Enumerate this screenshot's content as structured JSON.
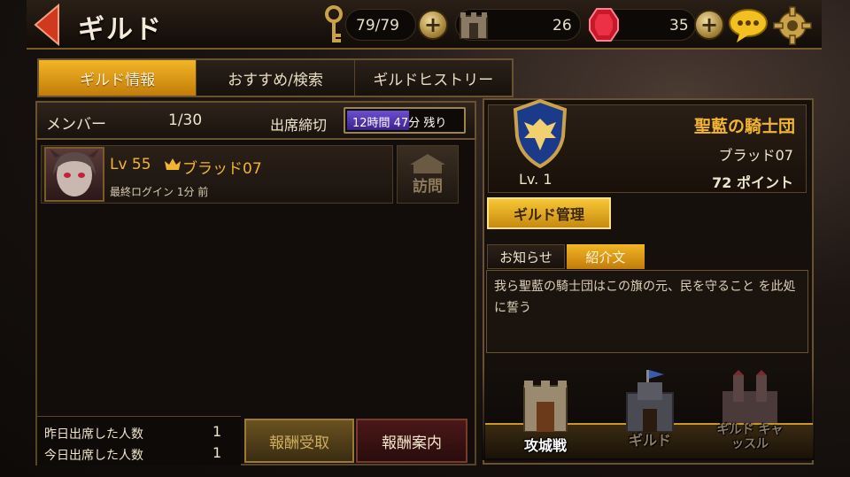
{
  "header": {
    "title": "ギルド",
    "keys": "79/79",
    "castles": "26",
    "gems": "35"
  },
  "tabs": [
    "ギルド情報",
    "おすすめ/検索",
    "ギルドヒストリー"
  ],
  "members": {
    "label": "メンバー",
    "count": "1/30",
    "deadline_label": "出席締切",
    "deadline_value": "12時間 47分 残り",
    "rows": [
      {
        "level": "Lv 55",
        "name": "ブラッド07",
        "last_login": "最終ログイン 1分 前",
        "visit": "訪問"
      }
    ]
  },
  "stats": {
    "yesterday_label": "昨日出席した人数",
    "yesterday_value": "1",
    "today_label": "今日出席した人数",
    "today_value": "1"
  },
  "buttons": {
    "receive": "報酬受取",
    "guide": "報酬案内",
    "manage": "ギルド管理"
  },
  "guild": {
    "name": "聖藍の騎士団",
    "master": "ブラッド07",
    "points": "72 ポイント",
    "level": "Lv. 1"
  },
  "info_tabs": [
    "お知らせ",
    "紹介文"
  ],
  "intro_text": "我ら聖藍の騎士団はこの旗の元、民を守ること を此処に誓う",
  "bottom_menu": [
    "攻城戦",
    "ギルド",
    "ギルド キャッスル"
  ],
  "colors": {
    "accent": "#f1b531",
    "tab_active": "#e0a018",
    "timer": "#5a3fc0"
  }
}
